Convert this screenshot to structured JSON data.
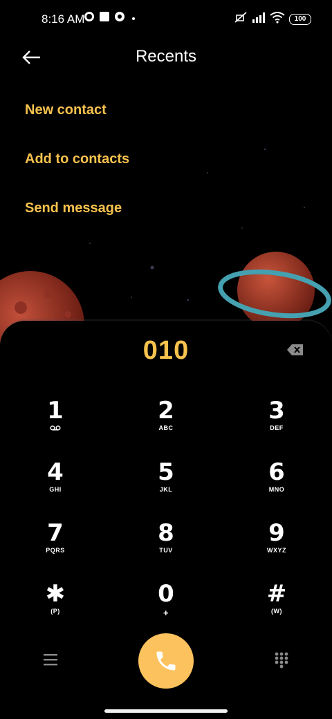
{
  "status_bar": {
    "time": "8:16 AM",
    "battery": "100",
    "icons": [
      "notification-icon",
      "notification-icon",
      "notification-icon",
      "dot-icon",
      "mute-icon",
      "signal-icon",
      "wifi-icon",
      "battery-icon"
    ]
  },
  "header": {
    "title": "Recents",
    "back_icon": "arrow-left-icon"
  },
  "actions": [
    {
      "label": "New contact"
    },
    {
      "label": "Add to contacts"
    },
    {
      "label": "Send message"
    }
  ],
  "dialer": {
    "number": "010",
    "keys": [
      {
        "digit": "1",
        "letters": ""
      },
      {
        "digit": "2",
        "letters": "ABC"
      },
      {
        "digit": "3",
        "letters": "DEF"
      },
      {
        "digit": "4",
        "letters": "GHI"
      },
      {
        "digit": "5",
        "letters": "JKL"
      },
      {
        "digit": "6",
        "letters": "MNO"
      },
      {
        "digit": "7",
        "letters": "PQRS"
      },
      {
        "digit": "8",
        "letters": "TUV"
      },
      {
        "digit": "9",
        "letters": "WXYZ"
      },
      {
        "digit": "✱",
        "letters": "(P)"
      },
      {
        "digit": "0",
        "letters": "+"
      },
      {
        "digit": "#",
        "letters": "(W)"
      }
    ]
  },
  "colors": {
    "accent": "#f7c24d",
    "call_button": "#fcc25e",
    "background": "#000000"
  }
}
